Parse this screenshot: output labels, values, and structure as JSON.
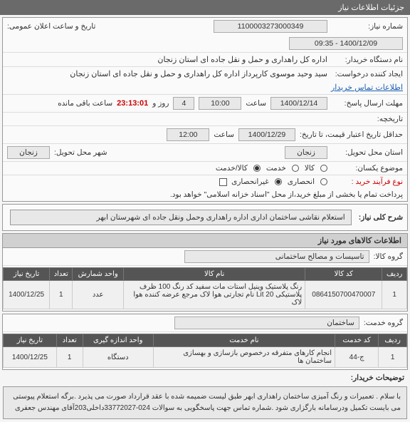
{
  "header": {
    "title": "جزئیات اطلاعات نیاز"
  },
  "fields": {
    "need_no_label": "شماره نیاز:",
    "need_no": "1100003273000349",
    "announce_label": "تاریخ و ساعت اعلان عمومی:",
    "announce_val": "1400/12/09 - 09:35",
    "buyer_org_label": "نام دستگاه خریدار:",
    "buyer_org": "اداره کل راهداری و حمل و نقل جاده ای استان زنجان",
    "creator_label": "ایجاد کننده درخواست:",
    "creator": "سید وحید موسوی کارپرداز اداره کل راهداری و حمل و نقل جاده ای استان زنجان",
    "contact_link": "اطلاعات تماس خریدار",
    "deadline_label": "مهلت ارسال پاسخ:",
    "deadline_date": "1400/12/14",
    "time_label": "ساعت",
    "deadline_time": "10:00",
    "day_label": "روز و",
    "days_left": "4",
    "countdown": "23:13:01",
    "remain_label": "ساعت باقی مانده",
    "history_label": "تاریخچه:",
    "min_valid_label": "حداقل تاریخ اعتبار قیمت، تا تاریخ:",
    "min_valid_date": "1400/12/29",
    "min_valid_time": "12:00",
    "province_label": "استان محل تحویل:",
    "province": "زنجان",
    "city_label": "شهر محل تحویل:",
    "city": "زنجان",
    "subject_type_label": "موضوع یکسان:",
    "opt_goods": "کالا",
    "opt_service": "خدمت",
    "opt_both": "کالا/خدمت",
    "process_label": "نوع فرآیند خرید :",
    "proc_exclusive": "انحصاری",
    "proc_non": "غیرانحصاری",
    "payment_note": "پرداخت تمام یا بخشی از مبلغ خرید،از محل \"اسناد خزانه اسلامی\" خواهد بود.",
    "desc_title_label": "شرح کلی نیاز:",
    "desc_text": "استعلام نقاشی ساختمان اداری  اداره راهداری وحمل ونقل جاده ای شهرستان ابهر"
  },
  "goods_section": {
    "title": "اطلاعات کالاهای مورد نیاز",
    "group_label": "گروه کالا:",
    "group_value": "تاسیسات و مصالح ساختمانی",
    "cols": {
      "row": "ردیف",
      "code": "کد کالا",
      "name": "نام کالا",
      "unit": "واحد شمارش",
      "qty": "تعداد",
      "deliver": "تاریخ نیاز"
    },
    "rows": [
      {
        "idx": "1",
        "code": "0864150700470007",
        "name": "رنگ پلاستیک وینیل استات مات سفید کد رنگ 100 ظرف پلاستیکی 20 Lit نام تجارتی هوا لاک مرجع عرضه کننده هوا لاک",
        "unit": "عدد",
        "qty": "1",
        "deliver": "1400/12/25"
      }
    ]
  },
  "service_section": {
    "group_label": "گروه خدمت:",
    "group_value": "ساختمان",
    "cols": {
      "row": "ردیف",
      "code": "کد خدمت",
      "name": "نام خدمت",
      "unit": "واحد اندازه گیری",
      "qty": "تعداد",
      "deliver": "تاریخ نیاز"
    },
    "rows": [
      {
        "idx": "1",
        "code": "ج-44",
        "name": "انجام کارهای متفرقه درخصوص بازسازی و بهسازی ساختمان ها",
        "unit": "دستگاه",
        "qty": "1",
        "deliver": "1400/12/25"
      }
    ]
  },
  "notes": {
    "label": "توضیحات خریدار:",
    "text": "با سلام . تعمیرات و رنگ آمیزی ساختمان راهداری ابهر طبق لیست ضمیمه شده با عقد قرارداد صورت می پذیرد .برگه استعلام پیوستی می بایست تکمیل ودرسامانه بارگزاری شود .شماره تماس جهت پاسخگویی به سوالات 024-33772027داخلی203آقای مهندس جعفری"
  }
}
